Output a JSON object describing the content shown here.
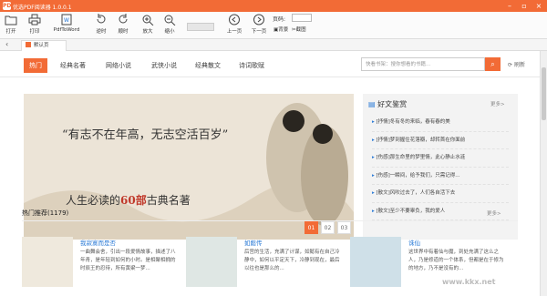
{
  "app": {
    "title": "优选PDF阅读器 1.0.0.1",
    "logo": "PDF"
  },
  "toolbar": {
    "open": "打开",
    "print": "打印",
    "pdf2word": "PdfToWord",
    "rotate_left": "逆时",
    "rotate_right": "顺时",
    "zoom_in": "放大",
    "zoom_out": "缩小",
    "prev": "上一页",
    "next": "下一页",
    "page_label": "页码:",
    "page_value": "",
    "bg": "背景",
    "snip": "截图"
  },
  "tabs": {
    "back": "‹",
    "default": "默认页"
  },
  "nav": {
    "items": [
      "热门",
      "经典名著",
      "网络小说",
      "武侠小说",
      "经典散文",
      "诗词歌赋"
    ]
  },
  "search": {
    "placeholder": "快看书架：搜你想看的书籍...",
    "refresh": "刷新"
  },
  "banner": {
    "line1": "“有志不在年高，无志空活百岁”",
    "line2_a": "人生必读的",
    "line2_b": "60部",
    "line2_c": "古典名著",
    "dots": [
      "01",
      "02",
      "03"
    ]
  },
  "side": {
    "title": "好文鉴赏",
    "more": "更多>",
    "items": [
      "[抒情]冬有冬的来临，春有春的美",
      "[抒情]梦到握住花落瓣，却转首在你面前",
      "[伤感]那生命里的梦里情，此心静止水涟",
      "[伤感]一瞬间，给予我们，只需记得...",
      "[散文]风吹过去了，人们各自活下去",
      "[散文]至少不要辜负，我的爱人"
    ]
  },
  "hot": {
    "title": "热门推荐(1179)",
    "more": "更多>"
  },
  "books": [
    {
      "title": "我寂寞而是否",
      "desc": "一曲舞会舍，引出一段爱情故事，描述了八年青，是年轻到如何的小时。是相聚相拥的时辰王的忍待，所有黄粱一梦..."
    },
    {
      "title": "如懿传",
      "desc": "后宫的生活，充满了计谋，如懿有在自己冷静中，如何以平定天下，冷静到现在，最后以往也是那么的..."
    },
    {
      "title": "诛仙",
      "desc": "这世界中有着仙与魔，到处充满了这么之人，乃是修道的一个体系，但都是在于修为的地方，乃不是没有的..."
    }
  ],
  "watermark": "www.kkx.net",
  "colors": {
    "accent": "#f26b36",
    "link": "#2a7ad6"
  }
}
